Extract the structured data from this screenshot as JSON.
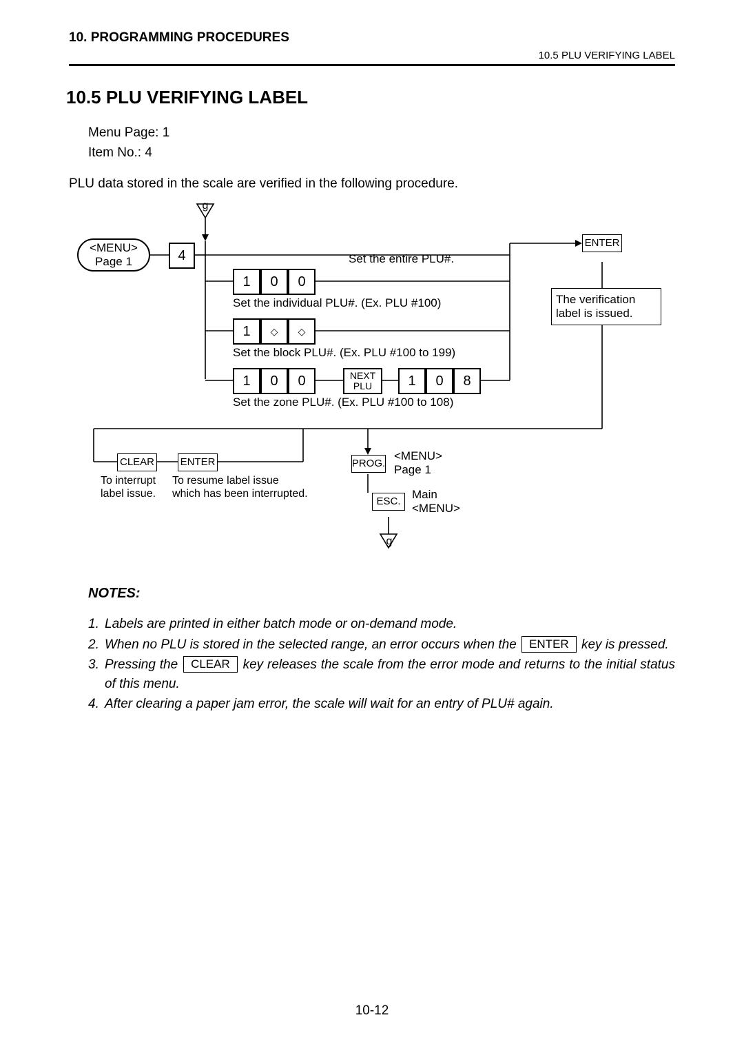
{
  "header": {
    "chapter": "10. PROGRAMMING PROCEDURES",
    "breadcrumb": "10.5 PLU VERIFYING LABEL"
  },
  "section_title": "10.5  PLU VERIFYING LABEL",
  "menu_info": {
    "line1": "Menu Page: 1",
    "line2": "Item No.:     4"
  },
  "intro": "PLU data stored in the scale are verified in the following procedure.",
  "diagram": {
    "start_g": "g",
    "menu_oval": "<MENU>\nPage 1",
    "key4": "4",
    "set_entire": "Set the entire PLU#.",
    "row1": {
      "a": "1",
      "b": "0",
      "c": "0"
    },
    "set_individual": "Set the individual PLU#.   (Ex. PLU #100)",
    "row2": {
      "a": "1",
      "b": "◇",
      "c": "◇"
    },
    "set_block": "Set the block PLU#.     (Ex. PLU #100 to 199)",
    "row3": {
      "a": "1",
      "b": "0",
      "c": "0",
      "next": "NEXT\nPLU",
      "d": "1",
      "e": "0",
      "f": "8"
    },
    "set_zone": "Set the zone PLU#.     (Ex. PLU #100 to 108)",
    "enter": "ENTER",
    "result_box": "The verification label is issued.",
    "clear": "CLEAR",
    "clear_note": "To interrupt\nlabel issue.",
    "enter2": "ENTER",
    "enter2_note": "To resume label issue\nwhich has been interrupted.",
    "prog": "PROG.",
    "prog_note": "<MENU>\nPage 1",
    "esc": "ESC.",
    "esc_note": "Main\n<MENU>",
    "end_g": "g"
  },
  "notes": {
    "heading": "NOTES:",
    "items": [
      {
        "num": "1.",
        "text": "Labels are printed in either batch mode or on-demand mode."
      },
      {
        "num": "2.",
        "pre": "When no PLU is stored in the selected range, an error occurs when the",
        "key": "ENTER",
        "post": "key is pressed."
      },
      {
        "num": "3.",
        "pre": "Pressing the",
        "key": "CLEAR",
        "post": " key releases the scale from the error mode and returns to the initial status of this menu."
      },
      {
        "num": "4.",
        "text": "After clearing a paper jam error, the scale will wait for an entry of PLU# again."
      }
    ]
  },
  "page_foot": "10-12"
}
